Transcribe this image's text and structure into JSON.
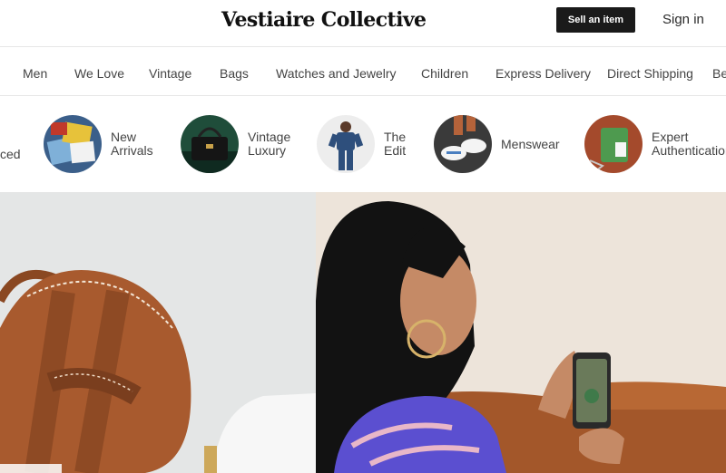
{
  "header": {
    "logo": "Vestiaire Collective",
    "sell_button": "Sell an item",
    "sign_in": "Sign in"
  },
  "nav": {
    "items": [
      "Men",
      "We Love",
      "Vintage",
      "Bags",
      "Watches and Jewelry",
      "Children",
      "Express Delivery",
      "Direct Shipping",
      "Be"
    ]
  },
  "categories": {
    "partial_left": "ced",
    "items": [
      {
        "label": "New\nArrivals"
      },
      {
        "label": "Vintage\nLuxury"
      },
      {
        "label": "The\nEdit"
      },
      {
        "label": "Menswear"
      },
      {
        "label": "Expert\nAuthentication"
      }
    ]
  },
  "colors": {
    "brand_dark": "#1a1a1a",
    "leather": "#a85a2e"
  }
}
